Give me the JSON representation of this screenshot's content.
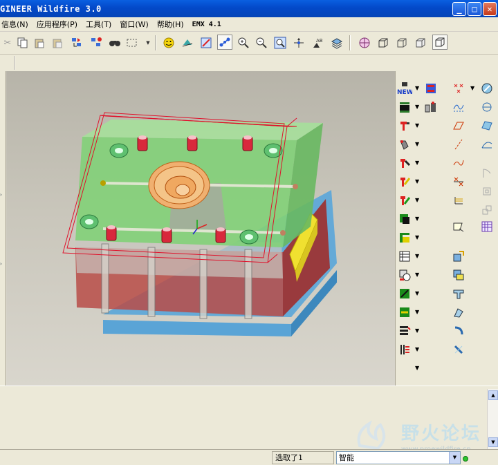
{
  "window": {
    "title": "GINEER Wildfire 3.0",
    "minimize_glyph": "_",
    "maximize_glyph": "□",
    "close_glyph": "✕"
  },
  "menu": {
    "items": [
      "信息(N)",
      "应用程序(P)",
      "工具(T)",
      "窗口(W)",
      "帮助(H)",
      "EMX 4.1"
    ]
  },
  "toolbar": {
    "icons": [
      "cut-icon",
      "copy-icon",
      "paste-icon",
      "paste-special-icon",
      "regenerate-icon",
      "regen-manager-icon",
      "find-icon",
      "select-box-icon",
      "smiley-icon",
      "spin-icon",
      "refit-icon",
      "orient-icon",
      "zoom-in-icon",
      "zoom-out-icon",
      "zoom-fit-icon",
      "spin-center-icon",
      "datum-display-icon",
      "layer-icon",
      "wireframe-icon",
      "hidden-line-icon",
      "no-hidden-icon",
      "shading-icon",
      "shaded-box-icon"
    ]
  },
  "right_toolbar": {
    "emx_new_label": "NEW"
  },
  "status": {
    "message": "选取了1",
    "filter_value": "智能"
  },
  "watermark": {
    "title": "野火论坛",
    "url": "www.proewildfire.cn"
  },
  "colors": {
    "title_bar": "#0349c9",
    "mold_green": "#7ecf7a",
    "mold_red": "#c04040",
    "mold_blue": "#6fb6e0",
    "bounding_box": "#e0102a"
  }
}
